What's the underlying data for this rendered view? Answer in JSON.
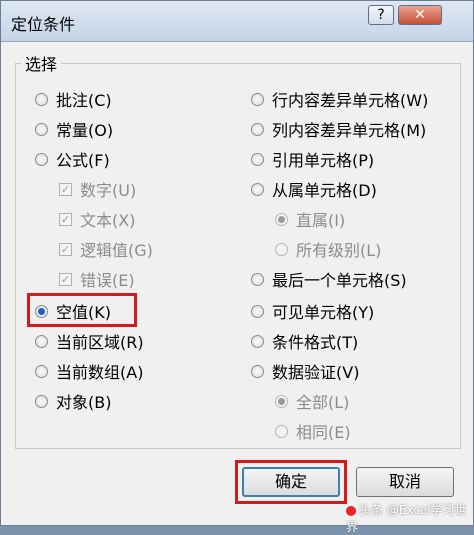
{
  "dialog": {
    "title": "定位条件",
    "help_label": "?",
    "close_label": "✕",
    "group_label": "选择"
  },
  "left_options": [
    {
      "label": "批注(C)",
      "control": "radio",
      "checked": false,
      "disabled": false
    },
    {
      "label": "常量(O)",
      "control": "radio",
      "checked": false,
      "disabled": false
    },
    {
      "label": "公式(F)",
      "control": "radio",
      "checked": false,
      "disabled": false
    },
    {
      "label": "数字(U)",
      "control": "checkbox",
      "checked": true,
      "disabled": true
    },
    {
      "label": "文本(X)",
      "control": "checkbox",
      "checked": true,
      "disabled": true
    },
    {
      "label": "逻辑值(G)",
      "control": "checkbox",
      "checked": true,
      "disabled": true
    },
    {
      "label": "错误(E)",
      "control": "checkbox",
      "checked": true,
      "disabled": true
    },
    {
      "label": "空值(K)",
      "control": "radio",
      "checked": true,
      "disabled": false
    },
    {
      "label": "当前区域(R)",
      "control": "radio",
      "checked": false,
      "disabled": false
    },
    {
      "label": "当前数组(A)",
      "control": "radio",
      "checked": false,
      "disabled": false
    },
    {
      "label": "对象(B)",
      "control": "radio",
      "checked": false,
      "disabled": false
    }
  ],
  "right_options": [
    {
      "label": "行内容差异单元格(W)",
      "control": "radio",
      "checked": false,
      "disabled": false
    },
    {
      "label": "列内容差异单元格(M)",
      "control": "radio",
      "checked": false,
      "disabled": false
    },
    {
      "label": "引用单元格(P)",
      "control": "radio",
      "checked": false,
      "disabled": false
    },
    {
      "label": "从属单元格(D)",
      "control": "radio",
      "checked": false,
      "disabled": false
    },
    {
      "label": "直属(I)",
      "control": "radio",
      "checked": true,
      "disabled": true
    },
    {
      "label": "所有级别(L)",
      "control": "radio",
      "checked": false,
      "disabled": true
    },
    {
      "label": "最后一个单元格(S)",
      "control": "radio",
      "checked": false,
      "disabled": false
    },
    {
      "label": "可见单元格(Y)",
      "control": "radio",
      "checked": false,
      "disabled": false
    },
    {
      "label": "条件格式(T)",
      "control": "radio",
      "checked": false,
      "disabled": false
    },
    {
      "label": "数据验证(V)",
      "control": "radio",
      "checked": false,
      "disabled": false
    },
    {
      "label": "全部(L)",
      "control": "radio",
      "checked": true,
      "disabled": true
    },
    {
      "label": "相同(E)",
      "control": "radio",
      "checked": false,
      "disabled": true
    }
  ],
  "buttons": {
    "ok_label": "确定",
    "cancel_label": "取消"
  },
  "watermark": "头条 @Excel学习世界",
  "colors": {
    "highlight": "#d7191c",
    "radio_selected": "#1f5fbf",
    "title_bar": "#c5d4e6"
  }
}
